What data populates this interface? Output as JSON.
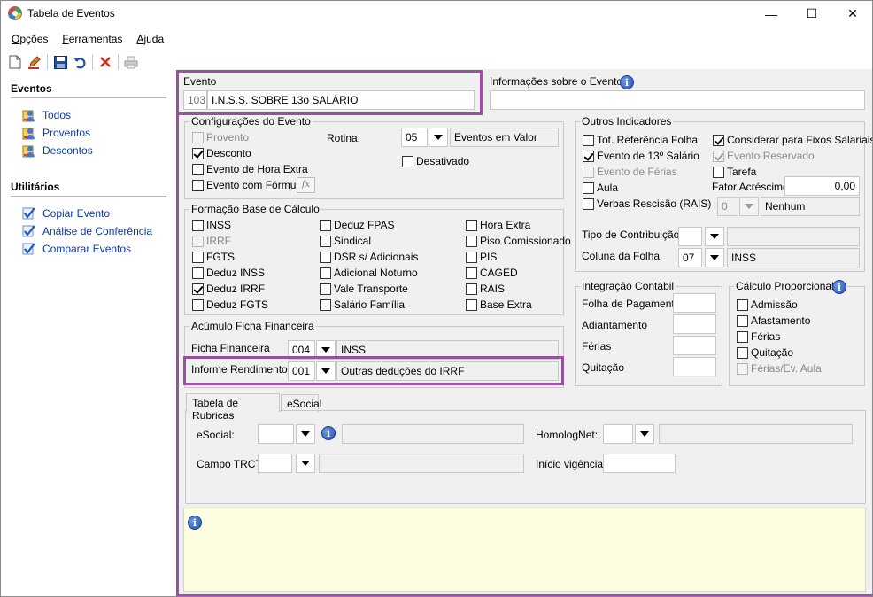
{
  "window": {
    "title": "Tabela de Eventos",
    "controls": [
      "—",
      "☐",
      "✕"
    ]
  },
  "menu": {
    "items": [
      {
        "label": "Opções",
        "underline_index": 0
      },
      {
        "label": "Ferramentas",
        "underline_index": 0
      },
      {
        "label": "Ajuda",
        "underline_index": 0
      }
    ]
  },
  "toolbar": {
    "icons": [
      "new-document-icon",
      "edit-icon",
      "save-icon",
      "undo-icon",
      "delete-icon",
      "print-icon"
    ]
  },
  "sidebar": {
    "eventos_title": "Eventos",
    "eventos_items": [
      "Todos",
      "Proventos",
      "Descontos"
    ],
    "utilitarios_title": "Utilitários",
    "utilitarios_items": [
      "Copiar Evento",
      "Análise de Conferência",
      "Comparar Eventos"
    ]
  },
  "evento": {
    "label": "Evento",
    "code": "103",
    "name": "I.N.S.S. SOBRE 13o SALÁRIO"
  },
  "info_evento": {
    "label": "Informações sobre o Evento",
    "value": ""
  },
  "config": {
    "title": "Configurações do Evento",
    "proventos": "Provento",
    "desconto": "Desconto",
    "hora_extra": "Evento de Hora Extra",
    "formula": "Evento com Fórmula",
    "formula_btn": "fx",
    "rotina_label": "Rotina:",
    "rotina_code": "05",
    "rotina_desc": "Eventos em Valor",
    "desativado": "Desativado"
  },
  "base_calculo": {
    "title": "Formação Base de Cálculo",
    "col1": [
      {
        "label": "INSS",
        "checked": false,
        "disabled": false
      },
      {
        "label": "IRRF",
        "checked": false,
        "disabled": true
      },
      {
        "label": "FGTS",
        "checked": false,
        "disabled": false
      },
      {
        "label": "Deduz INSS",
        "checked": false,
        "disabled": false
      },
      {
        "label": "Deduz IRRF",
        "checked": true,
        "disabled": false
      },
      {
        "label": "Deduz FGTS",
        "checked": false,
        "disabled": false
      }
    ],
    "col2": [
      {
        "label": "Deduz FPAS",
        "checked": false,
        "disabled": false
      },
      {
        "label": "Sindical",
        "checked": false,
        "disabled": false
      },
      {
        "label": "DSR s/ Adicionais",
        "checked": false,
        "disabled": false
      },
      {
        "label": "Adicional Noturno",
        "checked": false,
        "disabled": false
      },
      {
        "label": "Vale Transporte",
        "checked": false,
        "disabled": false
      },
      {
        "label": "Salário Família",
        "checked": false,
        "disabled": false
      }
    ],
    "col3": [
      {
        "label": "Hora Extra",
        "checked": false,
        "disabled": false
      },
      {
        "label": "Piso Comissionado",
        "checked": false,
        "disabled": false
      },
      {
        "label": "PIS",
        "checked": false,
        "disabled": false
      },
      {
        "label": "CAGED",
        "checked": false,
        "disabled": false
      },
      {
        "label": "RAIS",
        "checked": false,
        "disabled": false
      },
      {
        "label": "Base Extra",
        "checked": false,
        "disabled": false
      }
    ]
  },
  "acumulo": {
    "title": "Acúmulo Ficha Financeira",
    "ficha_label": "Ficha Financeira",
    "ficha_code": "004",
    "ficha_desc": "INSS",
    "informe_label": "Informe Rendimentos",
    "informe_code": "001",
    "informe_desc": "Outras deduções do IRRF"
  },
  "outros": {
    "title": "Outros Indicadores",
    "tot_ref": "Tot. Referência Folha",
    "considerar": "Considerar para Fixos Salariais",
    "evento13": "Evento de 13º Salário",
    "reservado": "Evento Reservado",
    "ferias": "Evento de Férias",
    "tarefa": "Tarefa",
    "aula": "Aula",
    "fator_label": "Fator Acréscimo",
    "fator_value": "0,00",
    "verbas": "Verbas Rescisão (RAIS)",
    "verbas_code": "0",
    "verbas_desc": "Nenhum",
    "tipo_label": "Tipo de Contribuição",
    "tipo_code": "",
    "tipo_desc": "",
    "coluna_label": "Coluna da Folha",
    "coluna_code": "07",
    "coluna_desc": "INSS"
  },
  "integracao": {
    "title": "Integração Contábil",
    "fields": [
      "Folha de Pagamento",
      "Adiantamento",
      "Férias",
      "Quitação"
    ]
  },
  "proporcional": {
    "title": "Cálculo Proporcional",
    "items": [
      {
        "label": "Admissão",
        "disabled": false
      },
      {
        "label": "Afastamento",
        "disabled": false
      },
      {
        "label": "Férias",
        "disabled": false
      },
      {
        "label": "Quitação",
        "disabled": false
      },
      {
        "label": "Férias/Ev. Aula",
        "disabled": true
      }
    ]
  },
  "tabs": {
    "items": [
      "Tabela de Rubricas",
      "eSocial"
    ]
  },
  "rubricas": {
    "esocial_label": "eSocial:",
    "homolog_label": "HomologNet:",
    "trct_label": "Campo TRCT:",
    "inicio_label": "Início vigência:"
  }
}
